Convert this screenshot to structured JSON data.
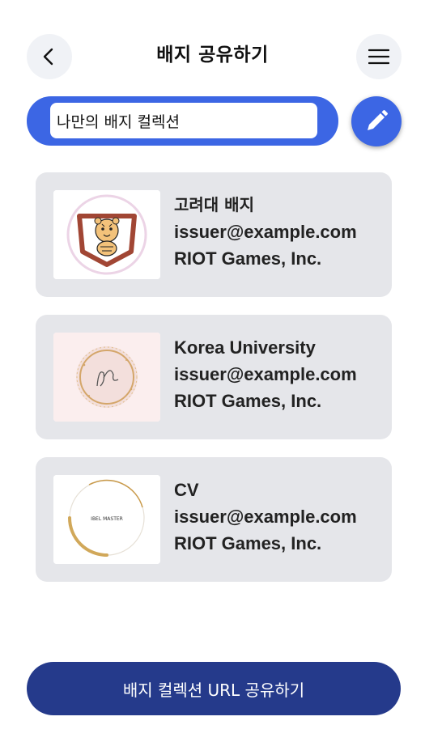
{
  "header": {
    "title": "배지 공유하기",
    "back_icon": "chevron-left-icon",
    "menu_icon": "hamburger-menu-icon"
  },
  "collection": {
    "name": "나만의 배지 컬렉션",
    "edit_icon": "pencil-icon",
    "accent_color": "#3c66e4"
  },
  "badges": [
    {
      "name": "고려대 배지",
      "email": "issuer@example.com",
      "issuer": "RIOT Games, Inc.",
      "image": "tiger-crest-badge"
    },
    {
      "name": "Korea University",
      "email": "issuer@example.com",
      "issuer": "RIOT Games, Inc.",
      "image": "rose-gold-monogram-badge"
    },
    {
      "name": "CV",
      "email": "issuer@example.com",
      "issuer": "RIOT Games, Inc.",
      "image": "gold-ring-badge",
      "image_text": "IBEL MASTER"
    }
  ],
  "share_button": {
    "label": "배지 컬렉션 URL 공유하기",
    "color": "#253a8b"
  }
}
